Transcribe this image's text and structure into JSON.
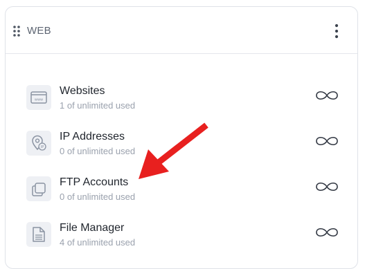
{
  "card": {
    "title": "WEB",
    "drag_icon": "drag-handle-icon",
    "menu_icon": "more-vertical-icon"
  },
  "rows": [
    {
      "label": "Websites",
      "usage": "1 of unlimited used",
      "icon": "browser-window-icon",
      "limit_icon": "infinity-icon"
    },
    {
      "label": "IP Addresses",
      "usage": "0 of unlimited used",
      "icon": "location-pin-ip-icon",
      "limit_icon": "infinity-icon"
    },
    {
      "label": "FTP Accounts",
      "usage": "0 of unlimited used",
      "icon": "copy-folders-icon",
      "limit_icon": "infinity-icon"
    },
    {
      "label": "File Manager",
      "usage": "4 of unlimited used",
      "icon": "document-file-icon",
      "limit_icon": "infinity-icon"
    }
  ],
  "annotation": {
    "arrow_color": "#e8201f",
    "arrow_icon": "red-pointer-arrow"
  },
  "colors": {
    "icon_tile": "#eef0f4",
    "icon_stroke": "#8a93a2",
    "border": "#dfe2e8"
  }
}
